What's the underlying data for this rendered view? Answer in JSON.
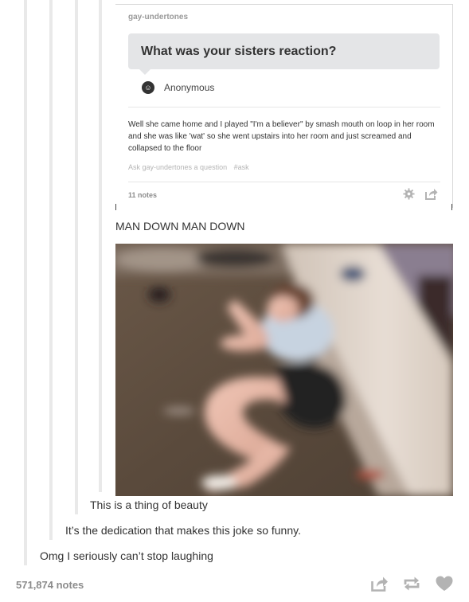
{
  "reblogged_post": {
    "blog_name": "gay-undertones",
    "question": "What was your sisters reaction?",
    "asker": "Anonymous",
    "answer": "Well she came home and I played \"I'm a believer\" by smash mouth on loop in her room and she was like 'wat' so she went upstairs into her room and just screamed and collapsed to the floor",
    "ask_link": "Ask gay-undertones a question",
    "tag": "#ask",
    "notes": "11 notes"
  },
  "caption": "MAN DOWN MAN DOWN",
  "comments": [
    "This is a thing of beauty",
    "It’s the dedication that makes this joke so funny.",
    "Omg I seriously can’t stop laughing"
  ],
  "footer": {
    "notes": "571,874 notes"
  },
  "icons": {
    "settings": "gear-icon",
    "card_share": "share-icon",
    "share": "share-icon",
    "reblog": "reblog-icon",
    "like": "heart-icon"
  },
  "colors": {
    "rule": "#e9e9e9",
    "question_bg": "#e4e5e7",
    "muted": "#8c8c8c",
    "icon": "#b3b3b3"
  }
}
